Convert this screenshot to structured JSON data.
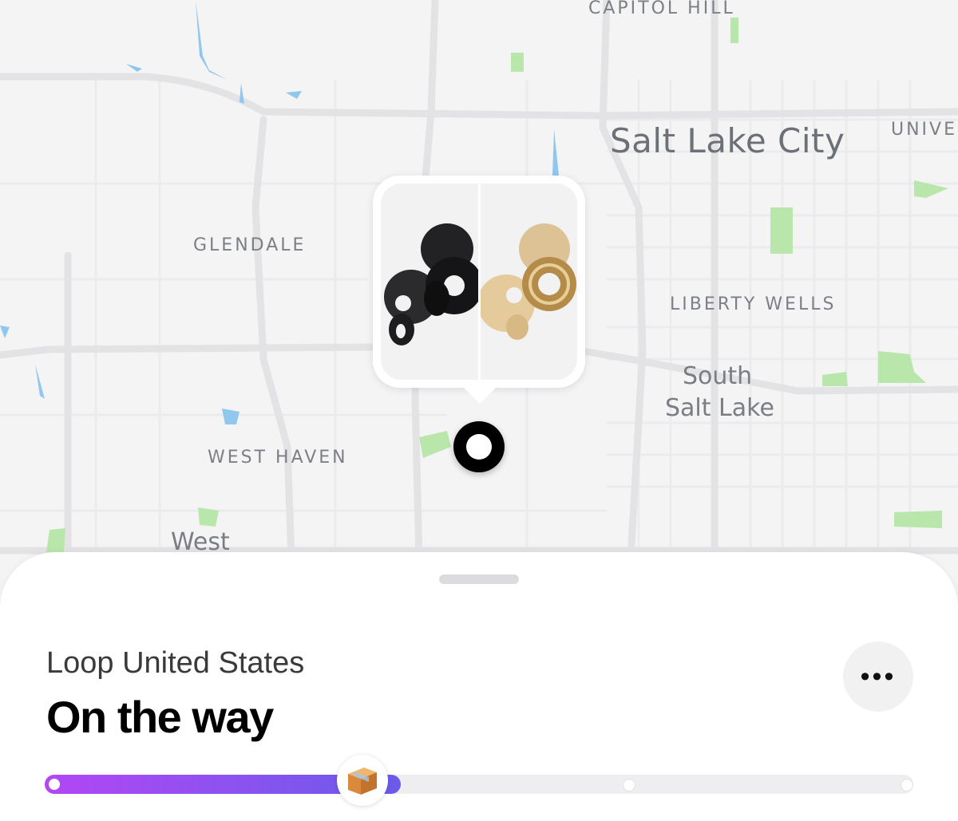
{
  "map": {
    "labels": {
      "capitol_hill": "CAPITOL HILL",
      "salt_lake_city": "Salt Lake City",
      "university": "UNIVE",
      "glendale": "GLENDALE",
      "liberty_wells": "LIBERTY WELLS",
      "south_salt_lake_1": "South",
      "south_salt_lake_2": "Salt Lake",
      "west_haven": "WEST HAVEN",
      "west": "West"
    },
    "colors": {
      "park": "#b8e8a8",
      "water": "#8ec8ef",
      "road": "#e4e4e7"
    }
  },
  "popup": {
    "image_icon": "earplugs-product-image",
    "variants": [
      "black",
      "gold"
    ]
  },
  "sheet": {
    "merchant": "Loop United States",
    "status": "On the way",
    "more_icon": "more-horizontal-icon",
    "more_label": "•••",
    "progress": {
      "fraction": 0.41,
      "steps": 4,
      "current_icon": "package-icon"
    },
    "colors": {
      "progress_start": "#b247f5",
      "progress_end": "#6b5bea"
    }
  }
}
